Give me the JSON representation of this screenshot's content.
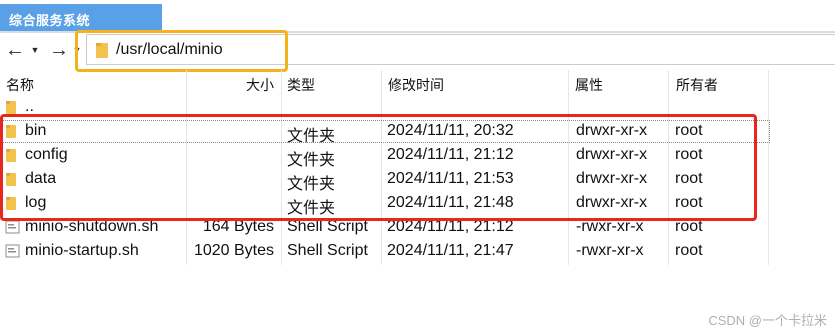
{
  "window": {
    "title": "综合服务系统"
  },
  "nav": {
    "path": "/usr/local/minio"
  },
  "columns": {
    "name": "名称",
    "size": "大小",
    "type": "类型",
    "mtime": "修改时间",
    "attr": "属性",
    "owner": "所有者"
  },
  "rows": [
    {
      "name": "..",
      "size": "",
      "type": "",
      "mtime": "",
      "attr": "",
      "owner": "",
      "icon": "folder-icon"
    },
    {
      "name": "bin",
      "size": "",
      "type": "文件夹",
      "mtime": "2024/11/11, 20:32",
      "attr": "drwxr-xr-x",
      "owner": "root",
      "icon": "folder-icon"
    },
    {
      "name": "config",
      "size": "",
      "type": "文件夹",
      "mtime": "2024/11/11, 21:12",
      "attr": "drwxr-xr-x",
      "owner": "root",
      "icon": "folder-icon"
    },
    {
      "name": "data",
      "size": "",
      "type": "文件夹",
      "mtime": "2024/11/11, 21:53",
      "attr": "drwxr-xr-x",
      "owner": "root",
      "icon": "folder-icon"
    },
    {
      "name": "log",
      "size": "",
      "type": "文件夹",
      "mtime": "2024/11/11, 21:48",
      "attr": "drwxr-xr-x",
      "owner": "root",
      "icon": "folder-icon"
    },
    {
      "name": "minio-shutdown.sh",
      "size": "164 Bytes",
      "type": "Shell Script",
      "mtime": "2024/11/11, 21:12",
      "attr": "-rwxr-xr-x",
      "owner": "root",
      "icon": "script-file-icon"
    },
    {
      "name": "minio-startup.sh",
      "size": "1020 Bytes",
      "type": "Shell Script",
      "mtime": "2024/11/11, 21:47",
      "attr": "-rwxr-xr-x",
      "owner": "root",
      "icon": "script-file-icon"
    }
  ],
  "watermark": "CSDN @一个卡拉米",
  "colors": {
    "title_tab": "#5aa0e6",
    "path_highlight": "#f5b21a",
    "selection_box": "#e8261e",
    "folder": "#f2c14e"
  }
}
